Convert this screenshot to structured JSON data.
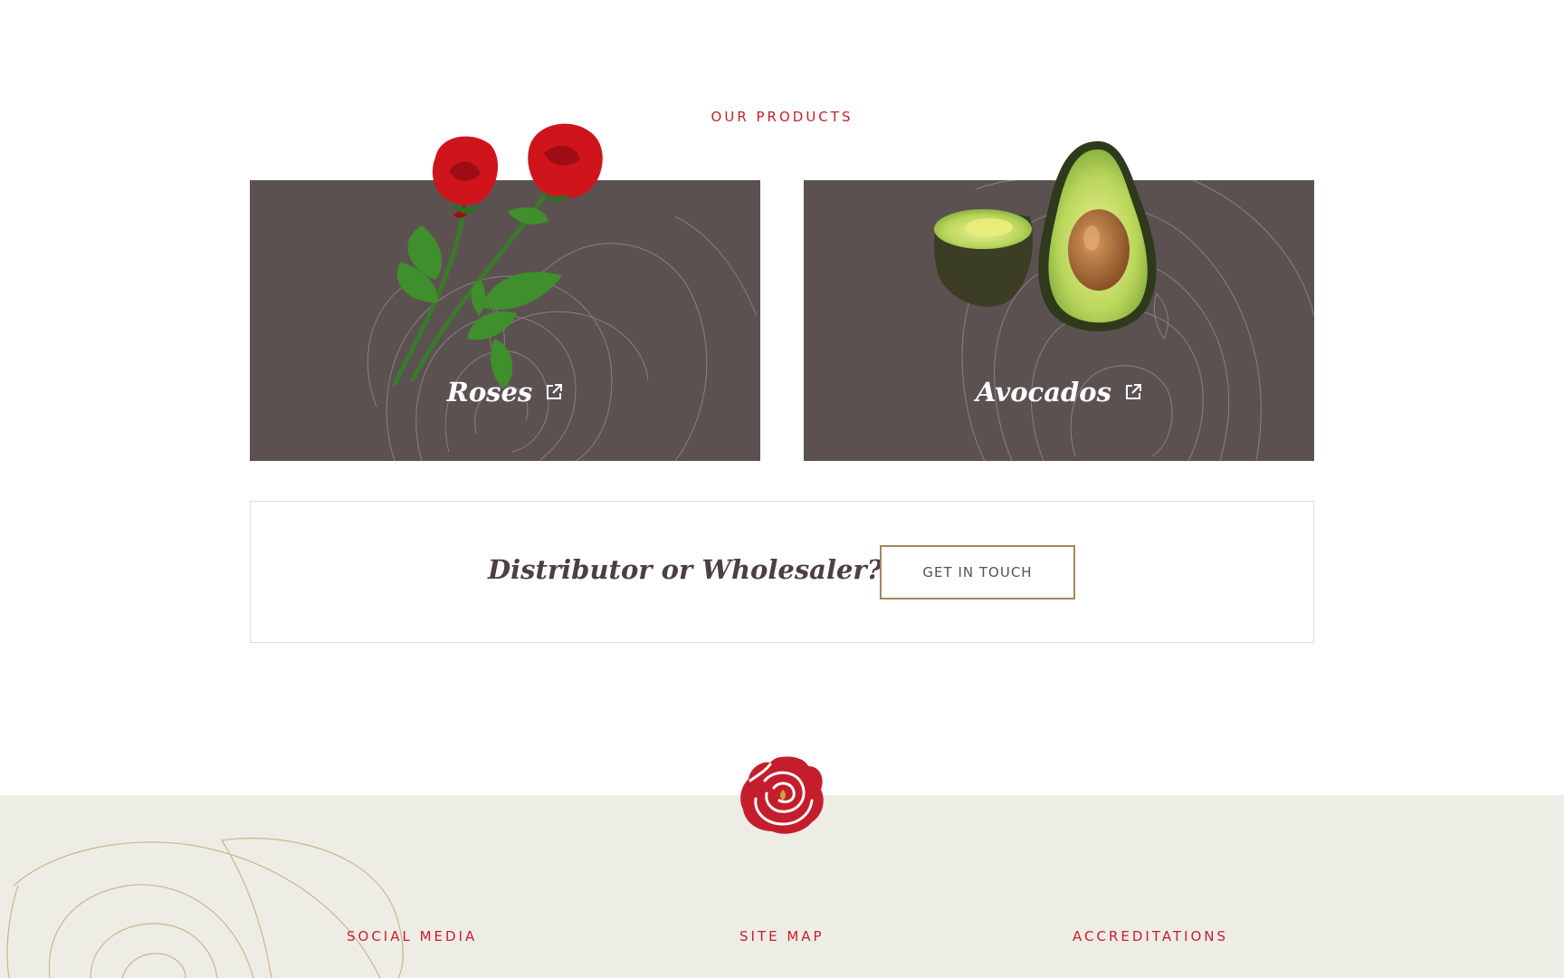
{
  "products_section": {
    "label": "OUR PRODUCTS",
    "cards": [
      {
        "title": "Roses",
        "image_icon": "rose-image",
        "link_icon": "external-link-icon"
      },
      {
        "title": "Avocados",
        "image_icon": "avocado-image",
        "link_icon": "external-link-icon"
      }
    ]
  },
  "cta": {
    "text": "Distributor or Wholesaler?",
    "button_label": "GET IN TOUCH"
  },
  "footer": {
    "logo_icon": "rose-logo-icon",
    "headings": [
      "SOCIAL MEDIA",
      "SITE MAP",
      "ACCREDITATIONS"
    ]
  },
  "colors": {
    "accent_red": "#c4202f",
    "card_bg": "#5c5151",
    "footer_bg": "#eeede5",
    "button_border": "#a3875a",
    "cta_text": "#4b3f40"
  }
}
